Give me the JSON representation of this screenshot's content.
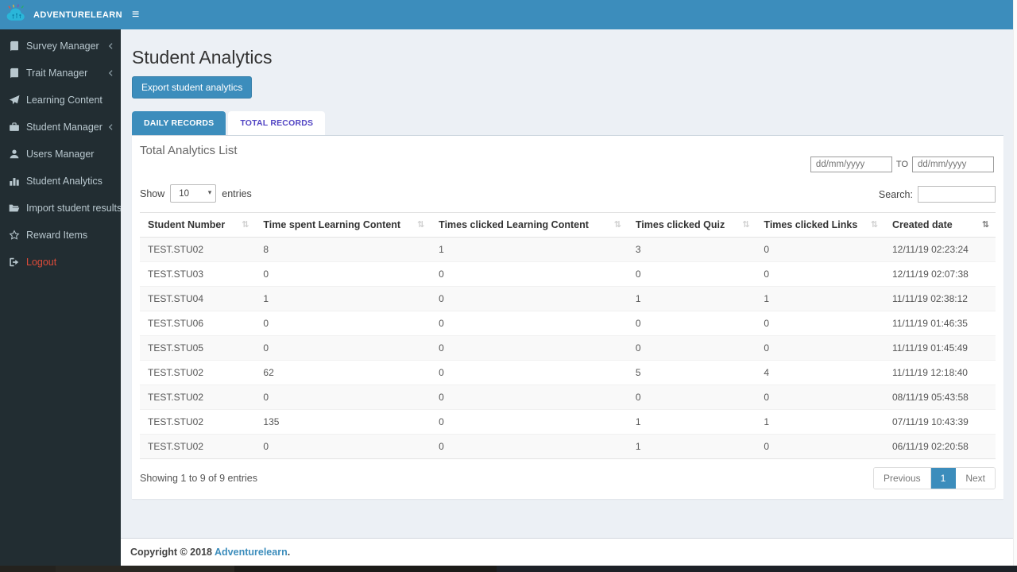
{
  "brand": {
    "name": "ADVENTURELEARN"
  },
  "icons": {
    "hamburger": "≡",
    "caret": "▾",
    "sort": "⇅"
  },
  "colors": {
    "accent": "#3c8dbc",
    "sidebar_bg": "#222d32",
    "sidebar_text": "#b8c7ce",
    "content_bg": "#ecf0f5",
    "danger": "#dd4b39",
    "tab_inactive_text": "#5346c4",
    "row_stripe": "#f9f9f9",
    "link": "#3c8dbc"
  },
  "sidebar": {
    "items": [
      {
        "label": "Survey Manager",
        "icon": "book-icon",
        "chevron": true
      },
      {
        "label": "Trait Manager",
        "icon": "book-icon",
        "chevron": true
      },
      {
        "label": "Learning Content",
        "icon": "paper-plane-icon",
        "chevron": false
      },
      {
        "label": "Student Manager",
        "icon": "briefcase-icon",
        "chevron": true
      },
      {
        "label": "Users Manager",
        "icon": "user-icon",
        "chevron": false
      },
      {
        "label": "Student Analytics",
        "icon": "bar-chart-icon",
        "chevron": false
      },
      {
        "label": "Import student results",
        "icon": "folder-open-icon",
        "chevron": false
      },
      {
        "label": "Reward Items",
        "icon": "star-icon",
        "chevron": false
      },
      {
        "label": "Logout",
        "icon": "sign-out-icon",
        "chevron": false
      }
    ]
  },
  "page": {
    "title": "Student Analytics",
    "export_button": "Export student analytics",
    "tabs": [
      {
        "label": "DAILY RECORDS",
        "active": true
      },
      {
        "label": "TOTAL RECORDS",
        "active": false
      }
    ],
    "panel_title": "Total Analytics List"
  },
  "filters": {
    "date_from_placeholder": "dd/mm/yyyy",
    "date_separator": "TO",
    "date_to_placeholder": "dd/mm/yyyy",
    "show_label": "Show",
    "page_length": "10",
    "entries_label": "entries",
    "search_label": "Search:"
  },
  "table": {
    "columns": [
      "Student Number",
      "Time spent Learning Content",
      "Times clicked Learning Content",
      "Times clicked Quiz",
      "Times clicked Links",
      "Created date"
    ],
    "rows": [
      [
        "TEST.STU02",
        "8",
        "1",
        "3",
        "0",
        "12/11/19 02:23:24"
      ],
      [
        "TEST.STU03",
        "0",
        "0",
        "0",
        "0",
        "12/11/19 02:07:38"
      ],
      [
        "TEST.STU04",
        "1",
        "0",
        "1",
        "1",
        "11/11/19 02:38:12"
      ],
      [
        "TEST.STU06",
        "0",
        "0",
        "0",
        "0",
        "11/11/19 01:46:35"
      ],
      [
        "TEST.STU05",
        "0",
        "0",
        "0",
        "0",
        "11/11/19 01:45:49"
      ],
      [
        "TEST.STU02",
        "62",
        "0",
        "5",
        "4",
        "11/11/19 12:18:40"
      ],
      [
        "TEST.STU02",
        "0",
        "0",
        "0",
        "0",
        "08/11/19 05:43:58"
      ],
      [
        "TEST.STU02",
        "135",
        "0",
        "1",
        "1",
        "07/11/19 10:43:39"
      ],
      [
        "TEST.STU02",
        "0",
        "0",
        "1",
        "0",
        "06/11/19 02:20:58"
      ]
    ],
    "summary": "Showing 1 to 9 of 9 entries"
  },
  "pagination": {
    "previous": "Previous",
    "current": "1",
    "next": "Next"
  },
  "footer": {
    "copyright": "Copyright © 2018",
    "brand_link": "Adventurelearn",
    "suffix": "."
  }
}
